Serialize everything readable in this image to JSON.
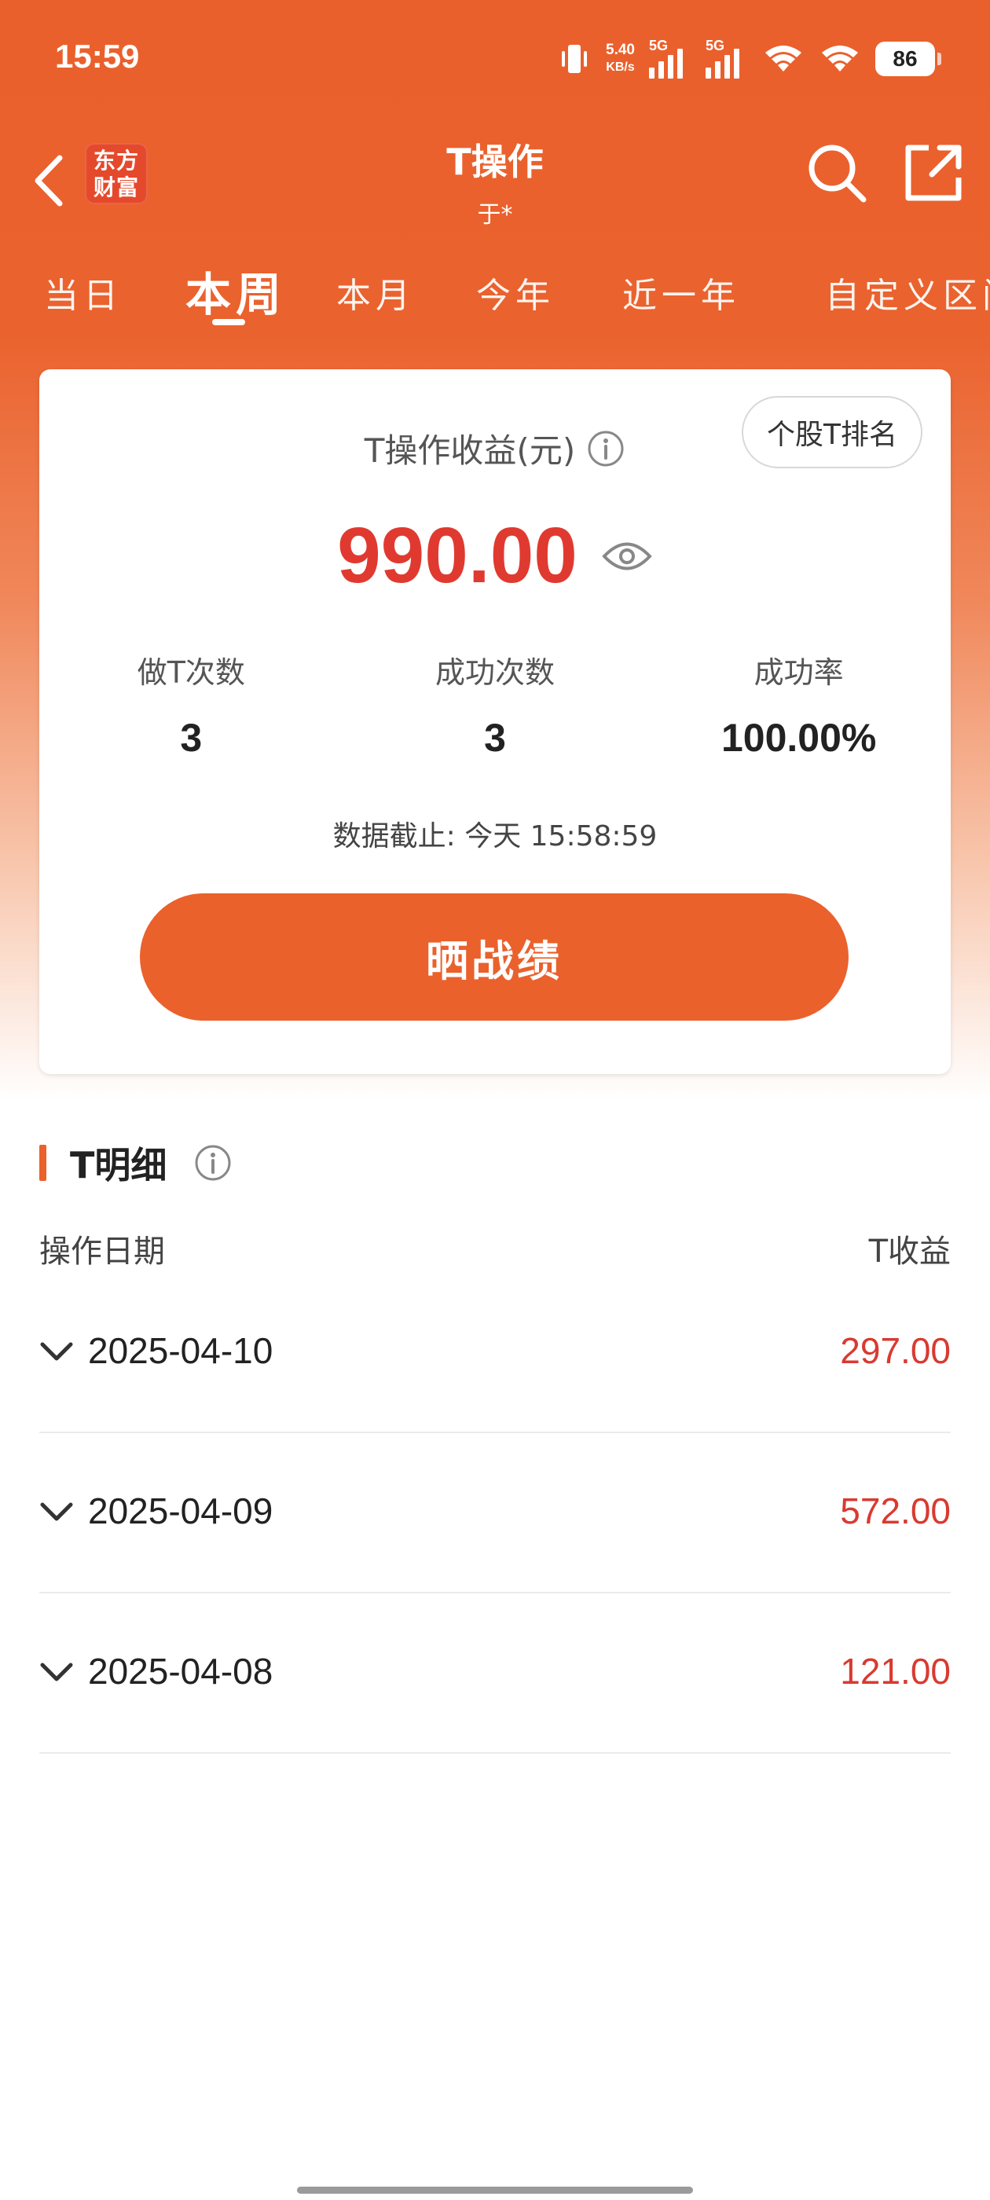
{
  "status_bar": {
    "time": "15:59",
    "net_speed_value": "5.40",
    "net_speed_unit": "KB/s",
    "sim1_label": "5G",
    "sim2_label": "5G",
    "battery": "86"
  },
  "header": {
    "logo_line1": "东方",
    "logo_line2": "财富",
    "title": "T操作",
    "subtitle": "于*"
  },
  "tabs": [
    {
      "label": "当日",
      "active": false
    },
    {
      "label": "本周",
      "active": true
    },
    {
      "label": "本月",
      "active": false
    },
    {
      "label": "今年",
      "active": false
    },
    {
      "label": "近一年",
      "active": false
    },
    {
      "label": "自定义区间",
      "active": false
    }
  ],
  "summary": {
    "rank_button": "个股T排名",
    "profit_label": "T操作收益(元)",
    "profit_value": "990.00",
    "stats": [
      {
        "label": "做T次数",
        "value": "3"
      },
      {
        "label": "成功次数",
        "value": "3"
      },
      {
        "label": "成功率",
        "value": "100.00%"
      }
    ],
    "data_time": "数据截止: 今天 15:58:59",
    "share_button": "晒战绩"
  },
  "detail": {
    "title": "T明细",
    "col_date": "操作日期",
    "col_profit": "T收益",
    "rows": [
      {
        "date": "2025-04-10",
        "profit": "297.00"
      },
      {
        "date": "2025-04-09",
        "profit": "572.00"
      },
      {
        "date": "2025-04-08",
        "profit": "121.00"
      }
    ]
  },
  "colors": {
    "brand_orange": "#EA612C",
    "profit_red": "#E03A30"
  },
  "icons": [
    "back-arrow-icon",
    "search-icon",
    "share-icon",
    "info-icon",
    "eye-icon",
    "chevron-down-icon"
  ]
}
